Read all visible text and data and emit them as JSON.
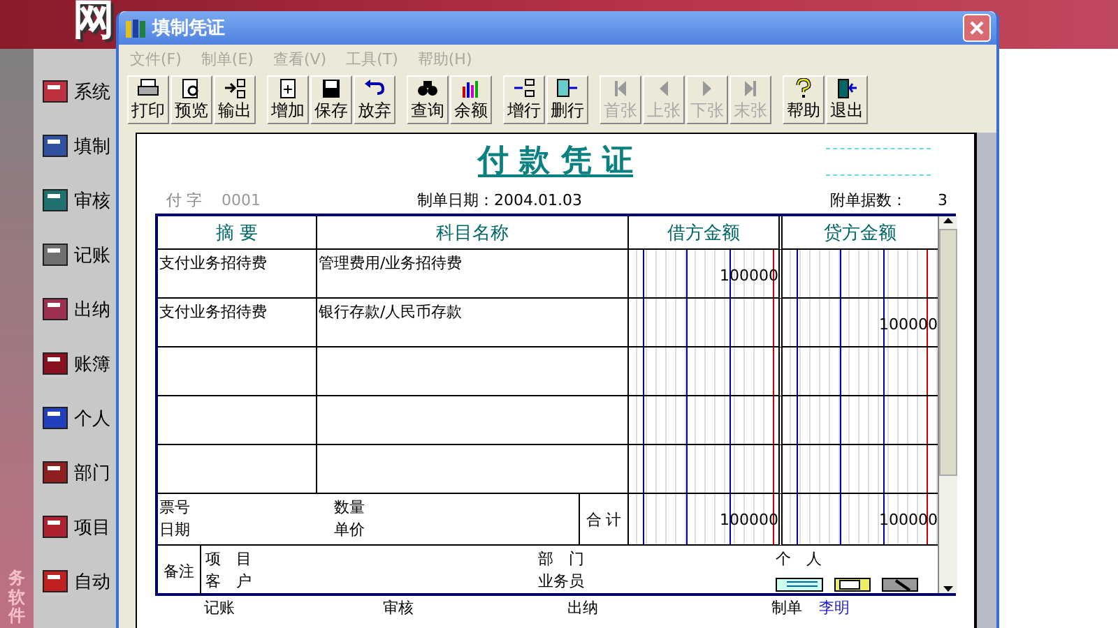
{
  "banner": {
    "title": "网"
  },
  "sidebar": {
    "caption": "务软件",
    "items": [
      {
        "label": "系统"
      },
      {
        "label": "填制"
      },
      {
        "label": "审核"
      },
      {
        "label": "记账"
      },
      {
        "label": "出纳"
      },
      {
        "label": "账簿"
      },
      {
        "label": "个人"
      },
      {
        "label": "部门"
      },
      {
        "label": "项目"
      },
      {
        "label": "自动"
      }
    ]
  },
  "window": {
    "title": "填制凭证"
  },
  "menu": [
    {
      "label": "文件(F)",
      "disabled": true
    },
    {
      "label": "制单(E)",
      "disabled": true
    },
    {
      "label": "查看(V)",
      "disabled": true
    },
    {
      "label": "工具(T)",
      "disabled": true
    },
    {
      "label": "帮助(H)",
      "disabled": true
    }
  ],
  "toolbar": [
    [
      {
        "label": "打印",
        "kind": "print",
        "disabled": false
      },
      {
        "label": "预览",
        "kind": "preview",
        "disabled": false
      },
      {
        "label": "输出",
        "kind": "export",
        "disabled": false
      }
    ],
    [
      {
        "label": "增加",
        "kind": "add",
        "disabled": false
      },
      {
        "label": "保存",
        "kind": "save",
        "disabled": false
      },
      {
        "label": "放弃",
        "kind": "undo",
        "disabled": false
      }
    ],
    [
      {
        "label": "查询",
        "kind": "find",
        "disabled": false
      },
      {
        "label": "余额",
        "kind": "chart",
        "disabled": false
      }
    ],
    [
      {
        "label": "增行",
        "kind": "insert",
        "disabled": false
      },
      {
        "label": "删行",
        "kind": "delete",
        "disabled": false
      }
    ],
    [
      {
        "label": "首张",
        "kind": "first",
        "disabled": true
      },
      {
        "label": "上张",
        "kind": "prev",
        "disabled": true
      },
      {
        "label": "下张",
        "kind": "next",
        "disabled": true
      },
      {
        "label": "末张",
        "kind": "last",
        "disabled": true
      }
    ],
    [
      {
        "label": "帮助",
        "kind": "help",
        "disabled": false
      },
      {
        "label": "退出",
        "kind": "exit",
        "disabled": false
      }
    ]
  ],
  "voucher": {
    "title": "付 款 凭 证",
    "type_label": "付 字",
    "number": "0001",
    "date": "制单日期：2004.01.03",
    "attachments_label": "附单据数：",
    "attachments": "3",
    "columns": [
      "摘 要",
      "科目名称",
      "借方金额",
      "贷方金额"
    ],
    "rows": [
      {
        "summary": "支付业务招待费",
        "account": "管理费用/业务招待费",
        "debit": "100000"
      },
      {
        "summary": "支付业务招待费",
        "account": "银行存款/人民币存款",
        "credit": "100000"
      }
    ],
    "ticket": "票号",
    "ticket_date": "日期",
    "quantity": "数量",
    "price": "单价",
    "total_label": "合 计",
    "debit_total": "100000",
    "credit_total": "100000",
    "note": "备注",
    "project": "项　目",
    "customer": "客　户",
    "department": "部　门",
    "staff": "业务员",
    "person": "个　人"
  },
  "signatures": [
    {
      "label": "记账"
    },
    {
      "label": "审核"
    },
    {
      "label": "出纳"
    },
    {
      "label": "制单",
      "value": "李明"
    }
  ]
}
